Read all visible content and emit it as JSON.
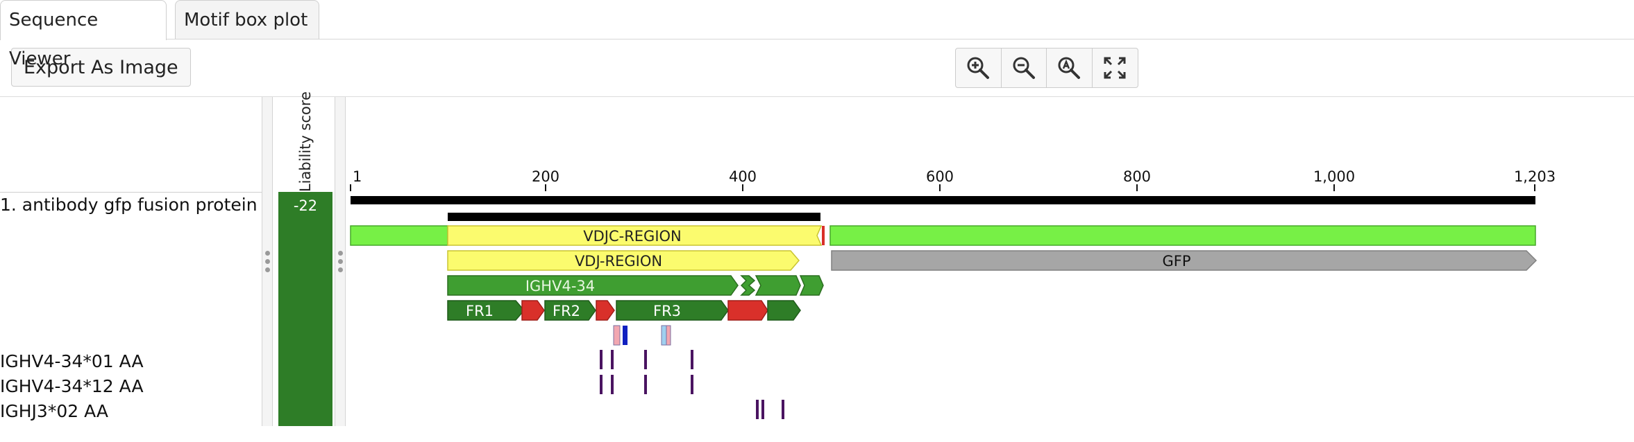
{
  "tabs": [
    {
      "label": "Sequence Viewer",
      "active": true
    },
    {
      "label": "Motif box plot",
      "active": false
    }
  ],
  "toolbar": {
    "export_label": "Export As Image",
    "zoom_buttons": [
      "zoom-in-icon",
      "zoom-out-icon",
      "zoom-reset-icon",
      "fit-to-screen-icon"
    ]
  },
  "liability": {
    "header": "Liability score",
    "value": "-22",
    "color": "#2e7d27"
  },
  "sequences": [
    {
      "name": "1. antibody gfp fusion protein"
    },
    {
      "name": "IGHV4-34*01 AA"
    },
    {
      "name": "IGHV4-34*12 AA"
    },
    {
      "name": "IGHJ3*02 AA"
    }
  ],
  "ruler": {
    "ticks": [
      "1",
      "200",
      "400",
      "600",
      "800",
      "1,000",
      "1,203"
    ]
  },
  "annotations": {
    "vdjc_region": "VDJC-REGION",
    "vdj_region": "VDJ-REGION",
    "gene": "IGHV4-34",
    "gfp": "GFP",
    "fr1": "FR1",
    "fr2": "FR2",
    "fr3": "FR3"
  },
  "colors": {
    "light_green": "#77f046",
    "yellow": "#fbfb6e",
    "green": "#3f9e31",
    "dark_green": "#2e7d27",
    "red": "#d9302a",
    "gray": "#a6a6a6",
    "purple": "#4a1461",
    "pink": "#f2a7b1",
    "light_blue": "#9fd0ef",
    "blue": "#1020c0"
  }
}
